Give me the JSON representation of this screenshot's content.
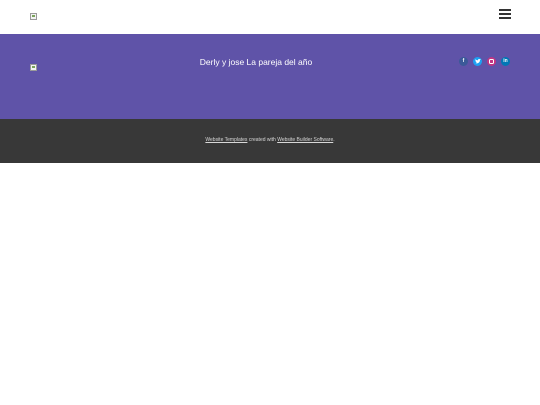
{
  "header": {
    "logo_icon": "broken-image-icon",
    "menu_icon": "hamburger-menu-icon"
  },
  "hero": {
    "logo_icon": "broken-image-icon",
    "title": "Derly y jose La pareja del año",
    "background_color": "#5f53a8",
    "social": {
      "facebook_glyph": "f",
      "twitter_icon": "twitter-bird-icon",
      "instagram_icon": "instagram-icon",
      "linkedin_glyph": "in"
    }
  },
  "footer": {
    "link1": "Website Templates",
    "middle": " created with ",
    "link2": "Website Builder Software",
    "end": ".",
    "background_color": "#383838"
  }
}
